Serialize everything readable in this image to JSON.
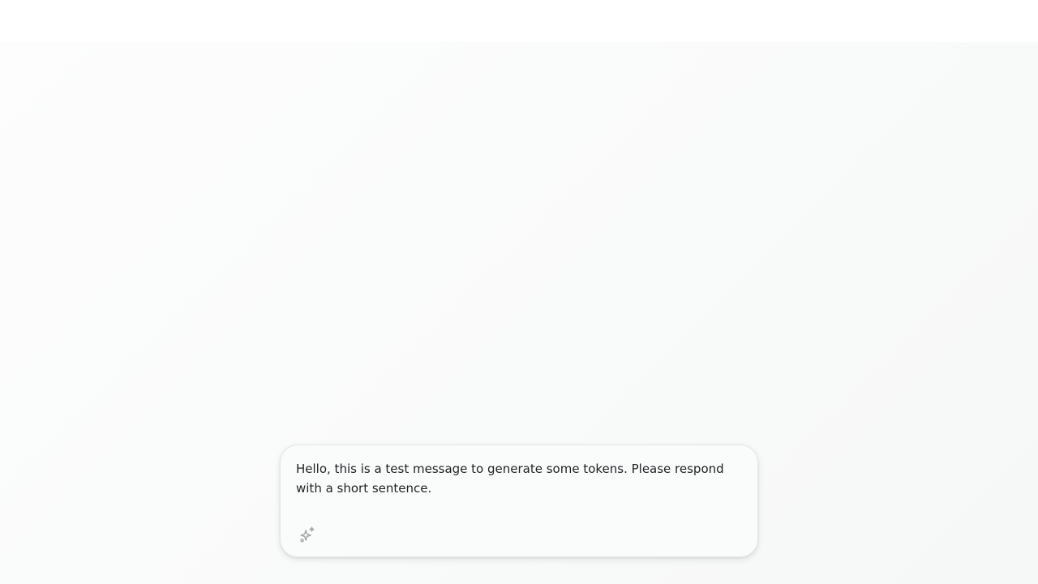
{
  "composer": {
    "text": "Hello, this is a test message to generate some tokens. Please respond with a short sentence.",
    "tool_icon": "sparkles-icon"
  },
  "colors": {
    "background": "#f9fafa",
    "composer_border": "#e4e5e6",
    "text": "#1f2123",
    "icon": "#a3a6a9"
  }
}
